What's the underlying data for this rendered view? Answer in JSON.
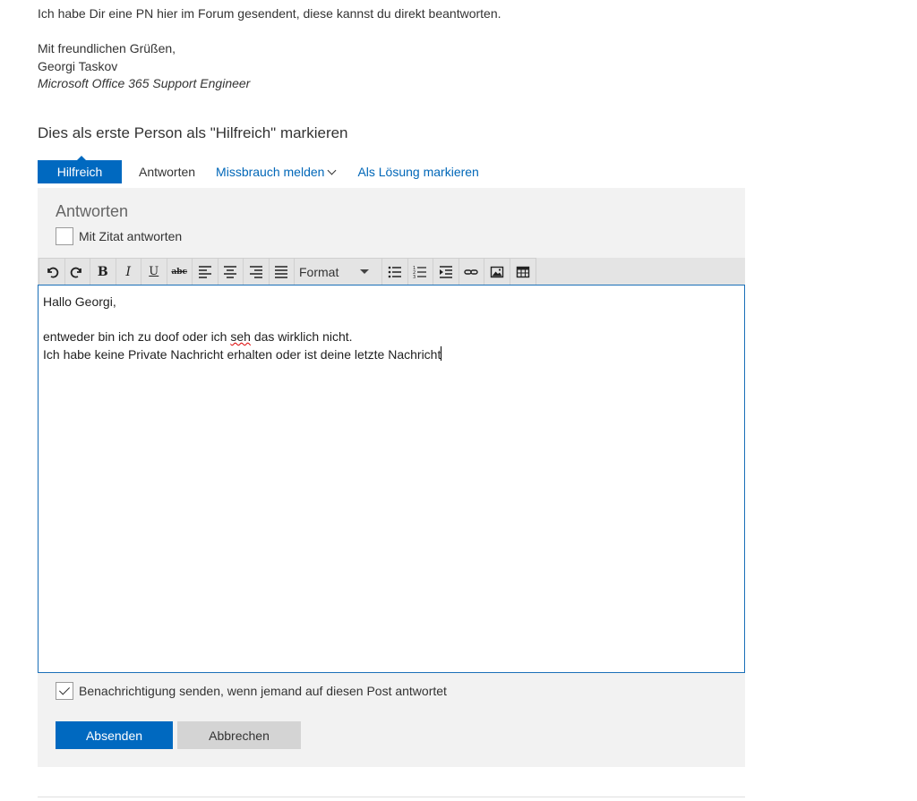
{
  "post": {
    "body_line": "Ich habe Dir eine PN hier im Forum gesendent, diese kannst du direkt beantworten.",
    "greeting": "Mit freundlichen Grüßen,",
    "author_name": "Georgi Taskov",
    "author_title": "Microsoft Office 365 Support Engineer"
  },
  "helpful_prompt": "Dies als erste Person als \"Hilfreich\" markieren",
  "actions": {
    "helpful": "Hilfreich",
    "reply": "Antworten",
    "report": "Missbrauch melden",
    "mark_solution": "Als Lösung markieren"
  },
  "reply_panel": {
    "title": "Antworten",
    "quote_label": "Mit Zitat antworten",
    "quote_checked": false,
    "toolbar": {
      "format_label": "Format",
      "bold": "B",
      "italic": "I",
      "underline": "U",
      "strike": "abc"
    },
    "editor": {
      "line1": "Hallo Georgi,",
      "line2_pre": "entweder bin ich zu doof oder ich ",
      "line2_misspelled": "seh",
      "line2_post": " das wirklich nicht.",
      "line3": "Ich habe keine Private Nachricht erhalten oder ist deine letzte Nachricht"
    },
    "notify_label": "Benachrichtigung senden, wenn jemand auf diesen Post antwortet",
    "notify_checked": true,
    "submit_label": "Absenden",
    "cancel_label": "Abbrechen"
  },
  "colors": {
    "accent": "#0069c0",
    "link": "#0067b8",
    "panel_bg": "#f2f2f2",
    "toolbar_bg": "#e4e4e4",
    "cancel_bg": "#d4d4d4"
  }
}
